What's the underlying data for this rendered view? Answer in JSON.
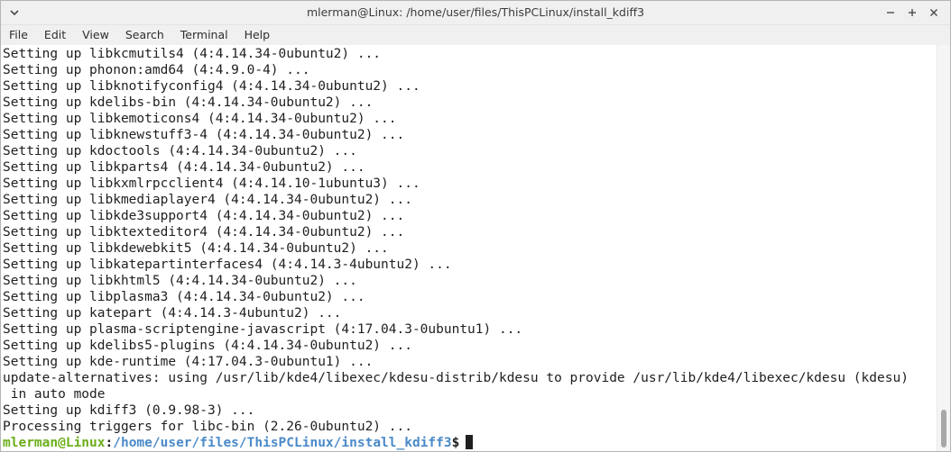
{
  "window": {
    "title": "mlerman@Linux: /home/user/files/ThisPCLinux/install_kdiff3",
    "controls": [
      "minimize-icon",
      "maximize-icon",
      "close-icon"
    ],
    "left_icon": "window-menu-icon"
  },
  "menubar": {
    "items": [
      "File",
      "Edit",
      "View",
      "Search",
      "Terminal",
      "Help"
    ]
  },
  "terminal": {
    "lines": [
      "Setting up libkcmutils4 (4:4.14.34-0ubuntu2) ...",
      "Setting up phonon:amd64 (4:4.9.0-4) ...",
      "Setting up libknotifyconfig4 (4:4.14.34-0ubuntu2) ...",
      "Setting up kdelibs-bin (4:4.14.34-0ubuntu2) ...",
      "Setting up libkemoticons4 (4:4.14.34-0ubuntu2) ...",
      "Setting up libknewstuff3-4 (4:4.14.34-0ubuntu2) ...",
      "Setting up kdoctools (4:4.14.34-0ubuntu2) ...",
      "Setting up libkparts4 (4:4.14.34-0ubuntu2) ...",
      "Setting up libkxmlrpcclient4 (4:4.14.10-1ubuntu3) ...",
      "Setting up libkmediaplayer4 (4:4.14.34-0ubuntu2) ...",
      "Setting up libkde3support4 (4:4.14.34-0ubuntu2) ...",
      "Setting up libktexteditor4 (4:4.14.34-0ubuntu2) ...",
      "Setting up libkdewebkit5 (4:4.14.34-0ubuntu2) ...",
      "Setting up libkatepartinterfaces4 (4:4.14.3-4ubuntu2) ...",
      "Setting up libkhtml5 (4:4.14.34-0ubuntu2) ...",
      "Setting up libplasma3 (4:4.14.34-0ubuntu2) ...",
      "Setting up katepart (4:4.14.3-4ubuntu2) ...",
      "Setting up plasma-scriptengine-javascript (4:17.04.3-0ubuntu1) ...",
      "Setting up kdelibs5-plugins (4:4.14.34-0ubuntu2) ...",
      "Setting up kde-runtime (4:17.04.3-0ubuntu1) ...",
      "update-alternatives: using /usr/lib/kde4/libexec/kdesu-distrib/kdesu to provide /usr/lib/kde4/libexec/kdesu (kdesu)",
      " in auto mode",
      "Setting up kdiff3 (0.9.98-3) ...",
      "Processing triggers for libc-bin (2.26-0ubuntu2) ..."
    ],
    "prompt": {
      "user_host": "mlerman@Linux",
      "separator": ":",
      "path": "/home/user/files/ThisPCLinux/install_kdiff3",
      "symbol": "$"
    }
  },
  "colors": {
    "prompt_user": "#6cae1a",
    "prompt_path": "#4a8ac9",
    "text": "#1f1f1f",
    "background": "#ffffff"
  }
}
